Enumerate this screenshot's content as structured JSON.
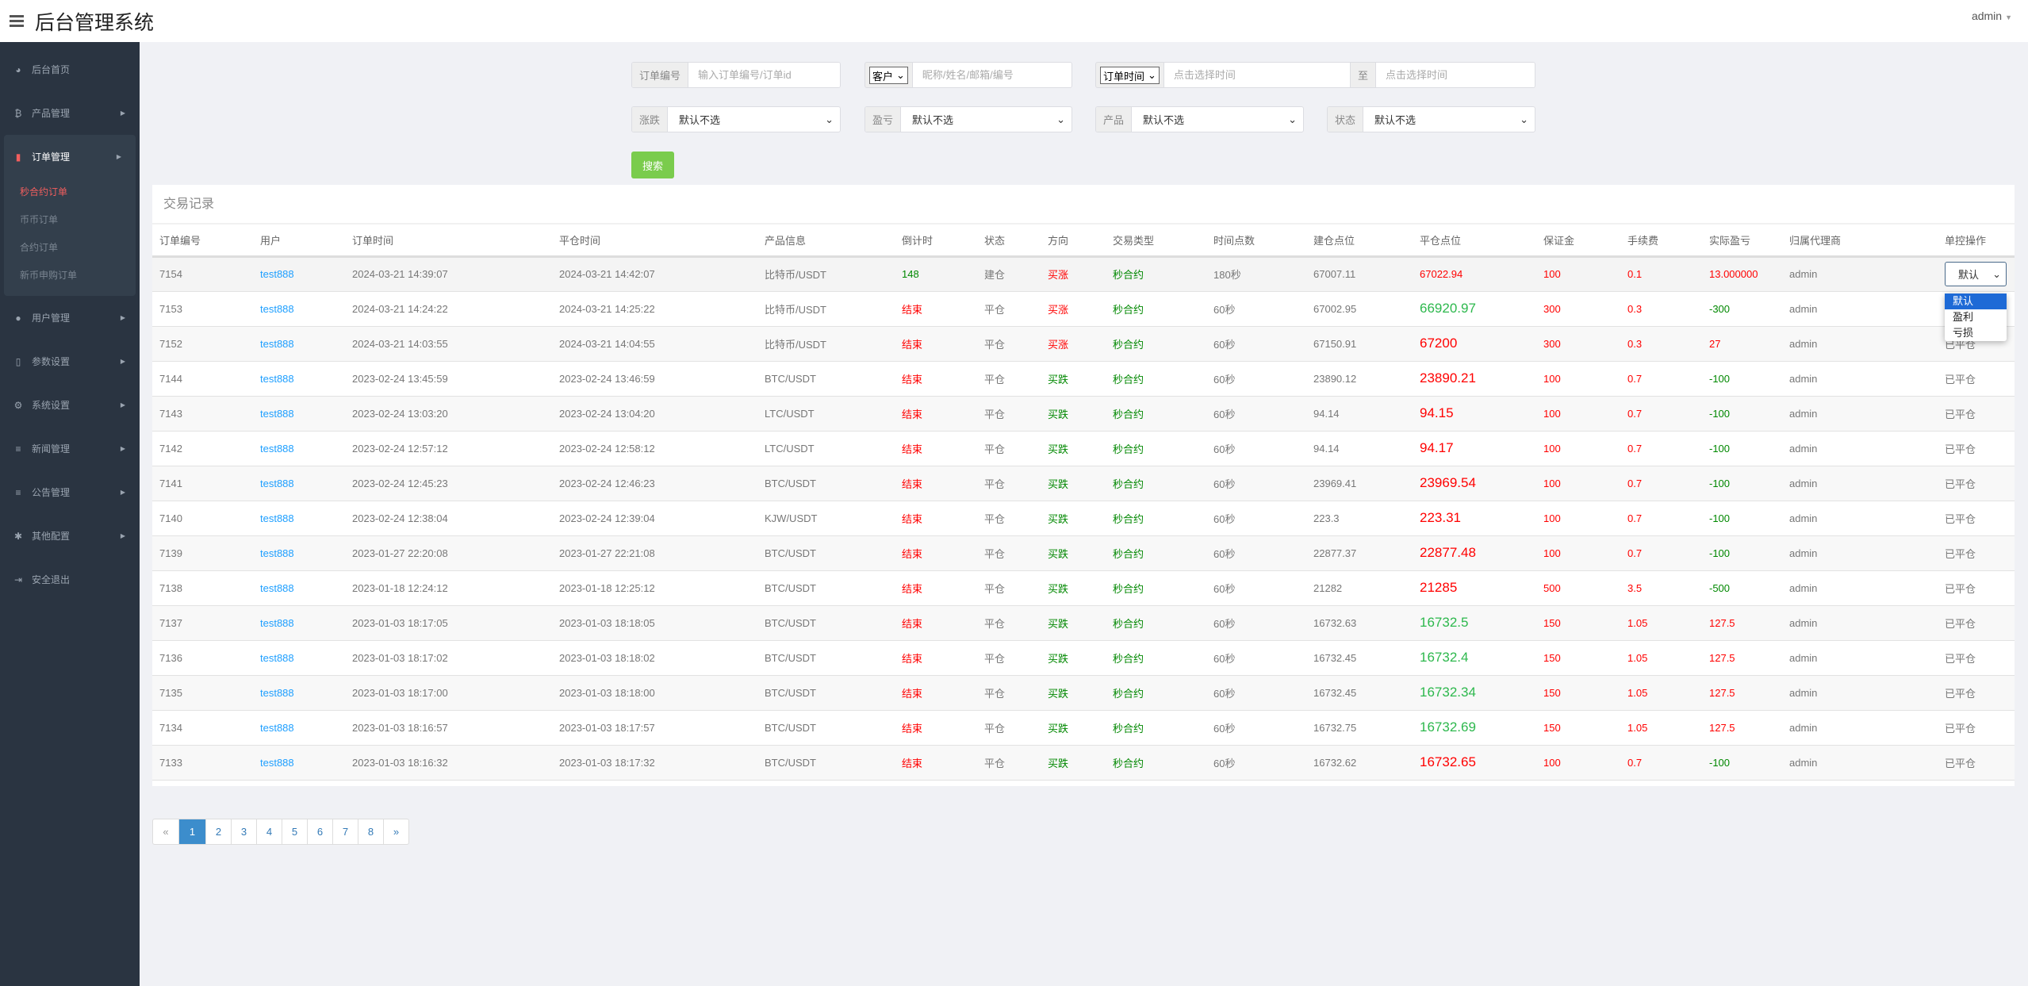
{
  "header": {
    "title": "后台管理系统",
    "user": "admin"
  },
  "sidebar": {
    "items": [
      {
        "label": "后台首页",
        "icon": "dashboard-icon",
        "glyph": "◕"
      },
      {
        "label": "产品管理",
        "icon": "bitcoin-icon",
        "glyph": "₿",
        "arrow": true
      },
      {
        "label": "订单管理",
        "icon": "file-icon",
        "glyph": "▮",
        "arrow": true,
        "expanded": true,
        "children": [
          "秒合约订单",
          "币币订单",
          "合约订单",
          "新币申购订单"
        ],
        "active_child": 0
      },
      {
        "label": "用户管理",
        "icon": "user-icon",
        "glyph": "●",
        "arrow": true
      },
      {
        "label": "参数设置",
        "icon": "document-icon",
        "glyph": "▯",
        "arrow": true
      },
      {
        "label": "系统设置",
        "icon": "gears-icon",
        "glyph": "⚙",
        "arrow": true
      },
      {
        "label": "新闻管理",
        "icon": "list-icon",
        "glyph": "≡",
        "arrow": true
      },
      {
        "label": "公告管理",
        "icon": "list-icon",
        "glyph": "≡",
        "arrow": true
      },
      {
        "label": "其他配置",
        "icon": "gear-icon",
        "glyph": "✱",
        "arrow": true
      },
      {
        "label": "安全退出",
        "icon": "sign-out-icon",
        "glyph": "⇥"
      }
    ]
  },
  "filters": {
    "order_no": {
      "label": "订单编号",
      "placeholder": "输入订单编号/订单id"
    },
    "customer": {
      "select": "客户",
      "placeholder": "昵称/姓名/邮箱/编号"
    },
    "time": {
      "select": "订单时间",
      "placeholder_from": "点击选择时间",
      "to": "至",
      "placeholder_to": "点击选择时间"
    },
    "rise_fall": {
      "label": "涨跌",
      "value": "默认不选"
    },
    "profit_loss": {
      "label": "盈亏",
      "value": "默认不选"
    },
    "product": {
      "label": "产品",
      "value": "默认不选"
    },
    "status": {
      "label": "状态",
      "value": "默认不选"
    },
    "search": "搜索"
  },
  "table": {
    "title": "交易记录",
    "columns": [
      "订单编号",
      "用户",
      "订单时间",
      "平仓时间",
      "产品信息",
      "倒计时",
      "状态",
      "方向",
      "交易类型",
      "时间点数",
      "建仓点位",
      "平仓点位",
      "保证金",
      "手续费",
      "实际盈亏",
      "归属代理商",
      "单控操作"
    ],
    "rows": [
      [
        "7154",
        "test888",
        "2024-03-21 14:39:07",
        "2024-03-21 14:42:07",
        "比特币/USDT",
        "148",
        "建仓",
        "买涨",
        "秒合约",
        "180秒",
        "67007.11",
        "67022.94",
        "100",
        "0.1",
        "13.000000",
        "admin",
        "默认"
      ],
      [
        "7153",
        "test888",
        "2024-03-21 14:24:22",
        "2024-03-21 14:25:22",
        "比特币/USDT",
        "结束",
        "平仓",
        "买涨",
        "秒合约",
        "60秒",
        "67002.95",
        "66920.97",
        "300",
        "0.3",
        "-300",
        "admin",
        "已平仓"
      ],
      [
        "7152",
        "test888",
        "2024-03-21 14:03:55",
        "2024-03-21 14:04:55",
        "比特币/USDT",
        "结束",
        "平仓",
        "买涨",
        "秒合约",
        "60秒",
        "67150.91",
        "67200",
        "300",
        "0.3",
        "27",
        "admin",
        "已平仓"
      ],
      [
        "7144",
        "test888",
        "2023-02-24 13:45:59",
        "2023-02-24 13:46:59",
        "BTC/USDT",
        "结束",
        "平仓",
        "买跌",
        "秒合约",
        "60秒",
        "23890.12",
        "23890.21",
        "100",
        "0.7",
        "-100",
        "admin",
        "已平仓"
      ],
      [
        "7143",
        "test888",
        "2023-02-24 13:03:20",
        "2023-02-24 13:04:20",
        "LTC/USDT",
        "结束",
        "平仓",
        "买跌",
        "秒合约",
        "60秒",
        "94.14",
        "94.15",
        "100",
        "0.7",
        "-100",
        "admin",
        "已平仓"
      ],
      [
        "7142",
        "test888",
        "2023-02-24 12:57:12",
        "2023-02-24 12:58:12",
        "LTC/USDT",
        "结束",
        "平仓",
        "买跌",
        "秒合约",
        "60秒",
        "94.14",
        "94.17",
        "100",
        "0.7",
        "-100",
        "admin",
        "已平仓"
      ],
      [
        "7141",
        "test888",
        "2023-02-24 12:45:23",
        "2023-02-24 12:46:23",
        "BTC/USDT",
        "结束",
        "平仓",
        "买跌",
        "秒合约",
        "60秒",
        "23969.41",
        "23969.54",
        "100",
        "0.7",
        "-100",
        "admin",
        "已平仓"
      ],
      [
        "7140",
        "test888",
        "2023-02-24 12:38:04",
        "2023-02-24 12:39:04",
        "KJW/USDT",
        "结束",
        "平仓",
        "买跌",
        "秒合约",
        "60秒",
        "223.3",
        "223.31",
        "100",
        "0.7",
        "-100",
        "admin",
        "已平仓"
      ],
      [
        "7139",
        "test888",
        "2023-01-27 22:20:08",
        "2023-01-27 22:21:08",
        "BTC/USDT",
        "结束",
        "平仓",
        "买跌",
        "秒合约",
        "60秒",
        "22877.37",
        "22877.48",
        "100",
        "0.7",
        "-100",
        "admin",
        "已平仓"
      ],
      [
        "7138",
        "test888",
        "2023-01-18 12:24:12",
        "2023-01-18 12:25:12",
        "BTC/USDT",
        "结束",
        "平仓",
        "买跌",
        "秒合约",
        "60秒",
        "21282",
        "21285",
        "500",
        "3.5",
        "-500",
        "admin",
        "已平仓"
      ],
      [
        "7137",
        "test888",
        "2023-01-03 18:17:05",
        "2023-01-03 18:18:05",
        "BTC/USDT",
        "结束",
        "平仓",
        "买跌",
        "秒合约",
        "60秒",
        "16732.63",
        "16732.5",
        "150",
        "1.05",
        "127.5",
        "admin",
        "已平仓"
      ],
      [
        "7136",
        "test888",
        "2023-01-03 18:17:02",
        "2023-01-03 18:18:02",
        "BTC/USDT",
        "结束",
        "平仓",
        "买跌",
        "秒合约",
        "60秒",
        "16732.45",
        "16732.4",
        "150",
        "1.05",
        "127.5",
        "admin",
        "已平仓"
      ],
      [
        "7135",
        "test888",
        "2023-01-03 18:17:00",
        "2023-01-03 18:18:00",
        "BTC/USDT",
        "结束",
        "平仓",
        "买跌",
        "秒合约",
        "60秒",
        "16732.45",
        "16732.34",
        "150",
        "1.05",
        "127.5",
        "admin",
        "已平仓"
      ],
      [
        "7134",
        "test888",
        "2023-01-03 18:16:57",
        "2023-01-03 18:17:57",
        "BTC/USDT",
        "结束",
        "平仓",
        "买跌",
        "秒合约",
        "60秒",
        "16732.75",
        "16732.69",
        "150",
        "1.05",
        "127.5",
        "admin",
        "已平仓"
      ],
      [
        "7133",
        "test888",
        "2023-01-03 18:16:32",
        "2023-01-03 18:17:32",
        "BTC/USDT",
        "结束",
        "平仓",
        "买跌",
        "秒合约",
        "60秒",
        "16732.62",
        "16732.65",
        "100",
        "0.7",
        "-100",
        "admin",
        "已平仓"
      ]
    ],
    "control_options": [
      "默认",
      "盈利",
      "亏损"
    ],
    "control_highlighted": 0
  },
  "pagination": {
    "prev": "«",
    "pages": [
      "1",
      "2",
      "3",
      "4",
      "5",
      "6",
      "7",
      "8"
    ],
    "current": "1",
    "next": "»"
  },
  "colors": {
    "sidebar": "#2a3441",
    "red": "#ff0000",
    "green": "#008800",
    "light_green": "#2db84d",
    "link": "#1e9fff",
    "search": "#7acc4d",
    "page_active": "#3c8dcc"
  }
}
